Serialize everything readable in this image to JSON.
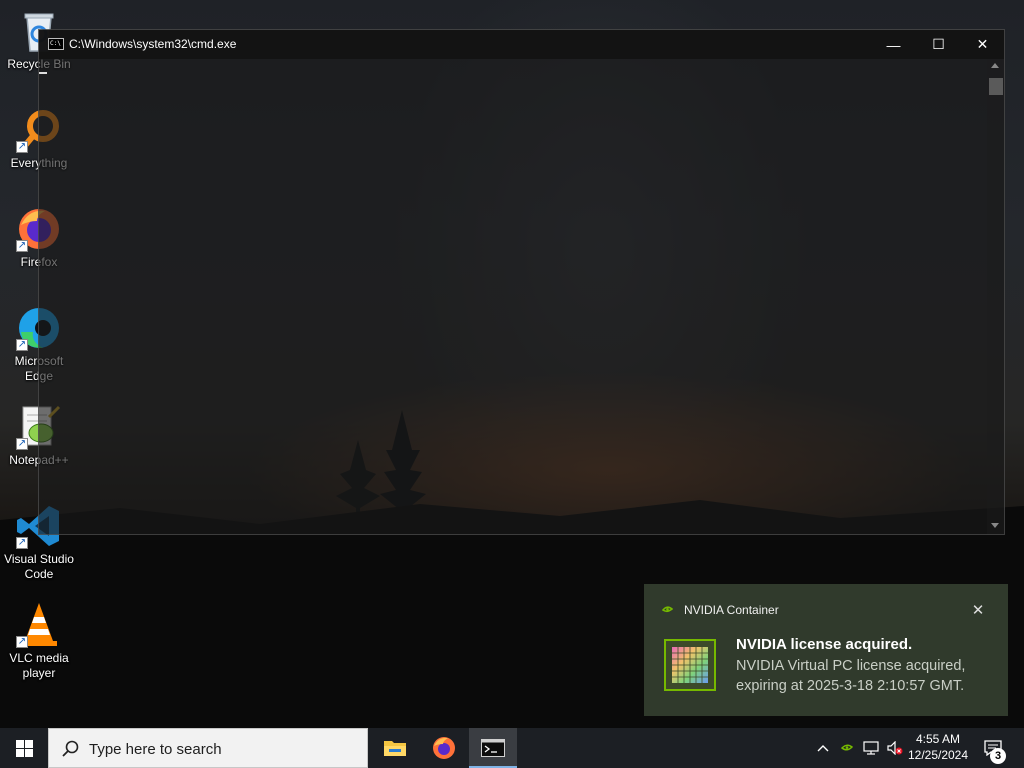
{
  "desktop": {
    "icons": [
      {
        "label": "Recycle Bin",
        "icon": "recycle-bin-icon"
      },
      {
        "label": "Everything",
        "icon": "everything-search-icon"
      },
      {
        "label": "Firefox",
        "icon": "firefox-icon"
      },
      {
        "label": "Microsoft Edge",
        "icon": "edge-icon"
      },
      {
        "label": "Notepad++",
        "icon": "notepadpp-icon"
      },
      {
        "label": "Visual Studio Code",
        "icon": "vscode-icon"
      },
      {
        "label": "VLC media player",
        "icon": "vlc-icon"
      }
    ]
  },
  "cmd_window": {
    "title": "C:\\Windows\\system32\\cmd.exe",
    "icon_text": "C:\\",
    "minimize_label": "—",
    "maximize_label": "☐",
    "close_label": "✕"
  },
  "notification": {
    "app_name": "NVIDIA Container",
    "title": "NVIDIA license acquired.",
    "body": "NVIDIA Virtual PC license acquired, expiring at 2025-3-18 2:10:57 GMT.",
    "close_label": "✕",
    "accent_color": "#76b900"
  },
  "taskbar": {
    "search_placeholder": "Type here to search",
    "pinned_apps": [
      "File Explorer",
      "Firefox",
      "Command Prompt"
    ],
    "active_app": "Command Prompt",
    "clock_time": "4:55 AM",
    "clock_date": "12/25/2024",
    "notification_count": "3",
    "tray_icons": [
      "chevron-up-icon",
      "nvidia-tray-icon",
      "network-icon",
      "volume-muted-icon"
    ]
  }
}
